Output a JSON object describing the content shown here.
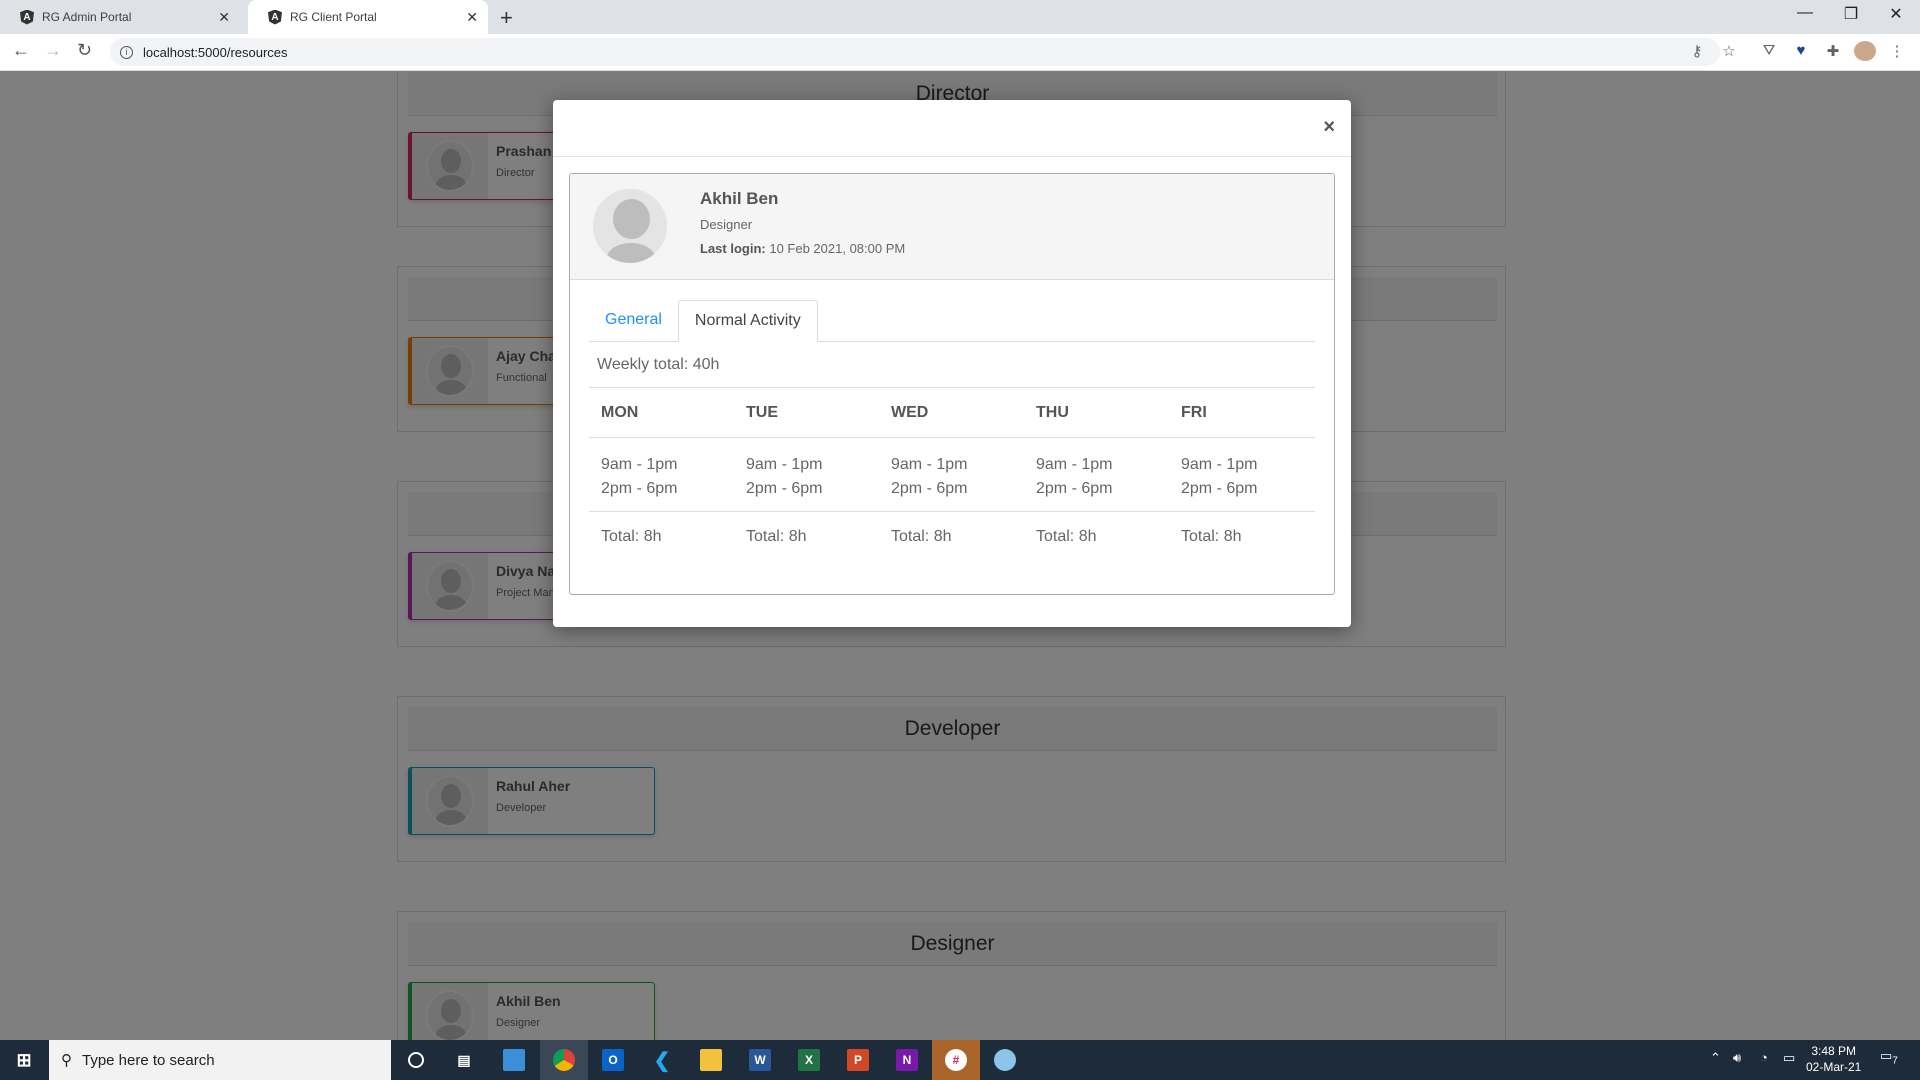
{
  "browser": {
    "tabs": [
      {
        "title": "RG Admin Portal",
        "active": false
      },
      {
        "title": "RG Client Portal",
        "active": true
      }
    ],
    "url": "localhost:5000/resources"
  },
  "page": {
    "sections": [
      {
        "title": "Director",
        "cards": [
          {
            "name": "Prashan",
            "role": "Director",
            "color": "#d6246e"
          }
        ]
      },
      {
        "title": "",
        "cards": [
          {
            "name": "Ajay Cha",
            "role": "Functional",
            "color": "#f07c00"
          }
        ]
      },
      {
        "title": "",
        "cards": [
          {
            "name": "Divya Na",
            "role": "Project Man",
            "color": "#b02fb0"
          }
        ]
      },
      {
        "title": "Developer",
        "cards": [
          {
            "name": "Rahul Aher",
            "role": "Developer",
            "color": "#17a2b8"
          }
        ]
      },
      {
        "title": "Designer",
        "cards": [
          {
            "name": "Akhil Ben",
            "role": "Designer",
            "color": "#28a745"
          }
        ]
      }
    ]
  },
  "modal": {
    "close_label": "×",
    "profile": {
      "name": "Akhil Ben",
      "role": "Designer",
      "last_login_label": "Last login:",
      "last_login_value": "10 Feb 2021, 08:00 PM"
    },
    "tabs": [
      {
        "label": "General",
        "active": false
      },
      {
        "label": "Normal Activity",
        "active": true
      }
    ],
    "weekly_total": "Weekly total: 40h",
    "days": [
      {
        "day": "MON",
        "slot1": "9am - 1pm",
        "slot2": "2pm - 6pm",
        "total": "Total: 8h"
      },
      {
        "day": "TUE",
        "slot1": "9am - 1pm",
        "slot2": "2pm - 6pm",
        "total": "Total: 8h"
      },
      {
        "day": "WED",
        "slot1": "9am - 1pm",
        "slot2": "2pm - 6pm",
        "total": "Total: 8h"
      },
      {
        "day": "THU",
        "slot1": "9am - 1pm",
        "slot2": "2pm - 6pm",
        "total": "Total: 8h"
      },
      {
        "day": "FRI",
        "slot1": "9am - 1pm",
        "slot2": "2pm - 6pm",
        "total": "Total: 8h"
      }
    ]
  },
  "taskbar": {
    "search_placeholder": "Type here to search",
    "time": "3:48 PM",
    "date": "02-Mar-21",
    "notifications": "7"
  }
}
